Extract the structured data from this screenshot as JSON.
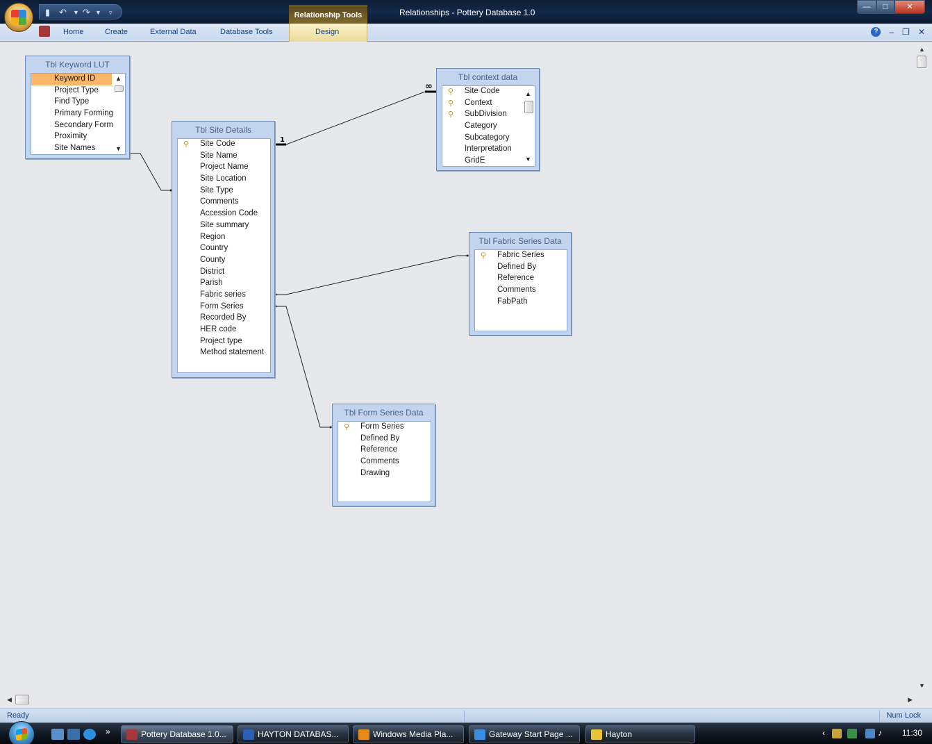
{
  "window": {
    "title": "Relationships - Pottery Database 1.0",
    "context_tab_header": "Relationship Tools"
  },
  "ribbon": {
    "tabs": [
      "Home",
      "Create",
      "External Data",
      "Database Tools",
      "Design"
    ]
  },
  "tables": {
    "keyword": {
      "title": "Tbl Keyword LUT",
      "fields": [
        {
          "name": "Keyword ID",
          "key": false,
          "selected": true
        },
        {
          "name": "Project Type",
          "key": false
        },
        {
          "name": "Find Type",
          "key": false
        },
        {
          "name": "Primary Forming",
          "key": false
        },
        {
          "name": "Secondary Form",
          "key": false
        },
        {
          "name": "Proximity",
          "key": false
        },
        {
          "name": "Site Names",
          "key": false
        }
      ]
    },
    "site": {
      "title": "Tbl Site Details",
      "fields": [
        {
          "name": "Site Code",
          "key": true
        },
        {
          "name": "Site Name",
          "key": false
        },
        {
          "name": "Project Name",
          "key": false
        },
        {
          "name": "Site Location",
          "key": false
        },
        {
          "name": "Site Type",
          "key": false
        },
        {
          "name": "Comments",
          "key": false
        },
        {
          "name": "Accession Code",
          "key": false
        },
        {
          "name": "Site summary",
          "key": false
        },
        {
          "name": "Region",
          "key": false
        },
        {
          "name": "Country",
          "key": false
        },
        {
          "name": "County",
          "key": false
        },
        {
          "name": "District",
          "key": false
        },
        {
          "name": "Parish",
          "key": false
        },
        {
          "name": "Fabric series",
          "key": false
        },
        {
          "name": "Form Series",
          "key": false
        },
        {
          "name": "Recorded By",
          "key": false
        },
        {
          "name": "HER code",
          "key": false
        },
        {
          "name": "Project type",
          "key": false
        },
        {
          "name": "Method statement",
          "key": false
        }
      ]
    },
    "context": {
      "title": "Tbl context data",
      "fields": [
        {
          "name": "Site Code",
          "key": true
        },
        {
          "name": "Context",
          "key": true
        },
        {
          "name": "SubDivision",
          "key": true
        },
        {
          "name": "Category",
          "key": false
        },
        {
          "name": "Subcategory",
          "key": false
        },
        {
          "name": "Interpretation",
          "key": false
        },
        {
          "name": "GridE",
          "key": false
        }
      ]
    },
    "fabric": {
      "title": "Tbl Fabric Series Data",
      "fields": [
        {
          "name": "Fabric Series",
          "key": true
        },
        {
          "name": "Defined By",
          "key": false
        },
        {
          "name": "Reference",
          "key": false
        },
        {
          "name": "Comments",
          "key": false
        },
        {
          "name": "FabPath",
          "key": false
        }
      ]
    },
    "form": {
      "title": "Tbl Form Series Data",
      "fields": [
        {
          "name": "Form Series",
          "key": true
        },
        {
          "name": "Defined By",
          "key": false
        },
        {
          "name": "Reference",
          "key": false
        },
        {
          "name": "Comments",
          "key": false
        },
        {
          "name": "Drawing",
          "key": false
        }
      ]
    }
  },
  "relationship_labels": {
    "one": "1",
    "many": "∞"
  },
  "statusbar": {
    "left": "Ready",
    "right": "Num Lock"
  },
  "taskbar": {
    "items": [
      {
        "label": "Pottery Database 1.0...",
        "color": "#a4373a"
      },
      {
        "label": "HAYTON DATABAS...",
        "color": "#2b5fb4"
      },
      {
        "label": "Windows Media Pla...",
        "color": "#e88a1a"
      },
      {
        "label": "Gateway Start Page ...",
        "color": "#3b8de0"
      },
      {
        "label": "Hayton",
        "color": "#e9c23a"
      }
    ],
    "clock": "11:30"
  }
}
